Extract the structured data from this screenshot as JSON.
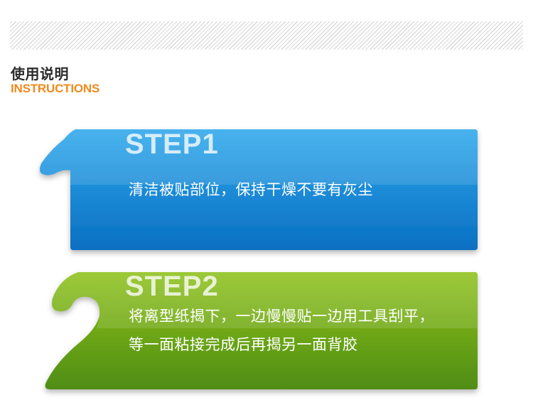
{
  "header": {
    "title_cn": "使用说明",
    "title_en": "INSTRUCTIONS"
  },
  "steps": [
    {
      "title": "STEP1",
      "lines": [
        "清洁被贴部位，保持干燥不要有灰尘"
      ]
    },
    {
      "title": "STEP2",
      "lines": [
        "将离型纸揭下，一边慢慢贴一边用工具刮平，",
        "等一面粘接完成后再揭另一面背胶"
      ]
    }
  ],
  "colors": {
    "accent_orange": "#f08a1c",
    "step1_blue_top": "#2fa8ec",
    "step1_blue_bottom": "#0a6fc2",
    "step2_green_top": "#8fc21c",
    "step2_green_bottom": "#4f8d14"
  }
}
